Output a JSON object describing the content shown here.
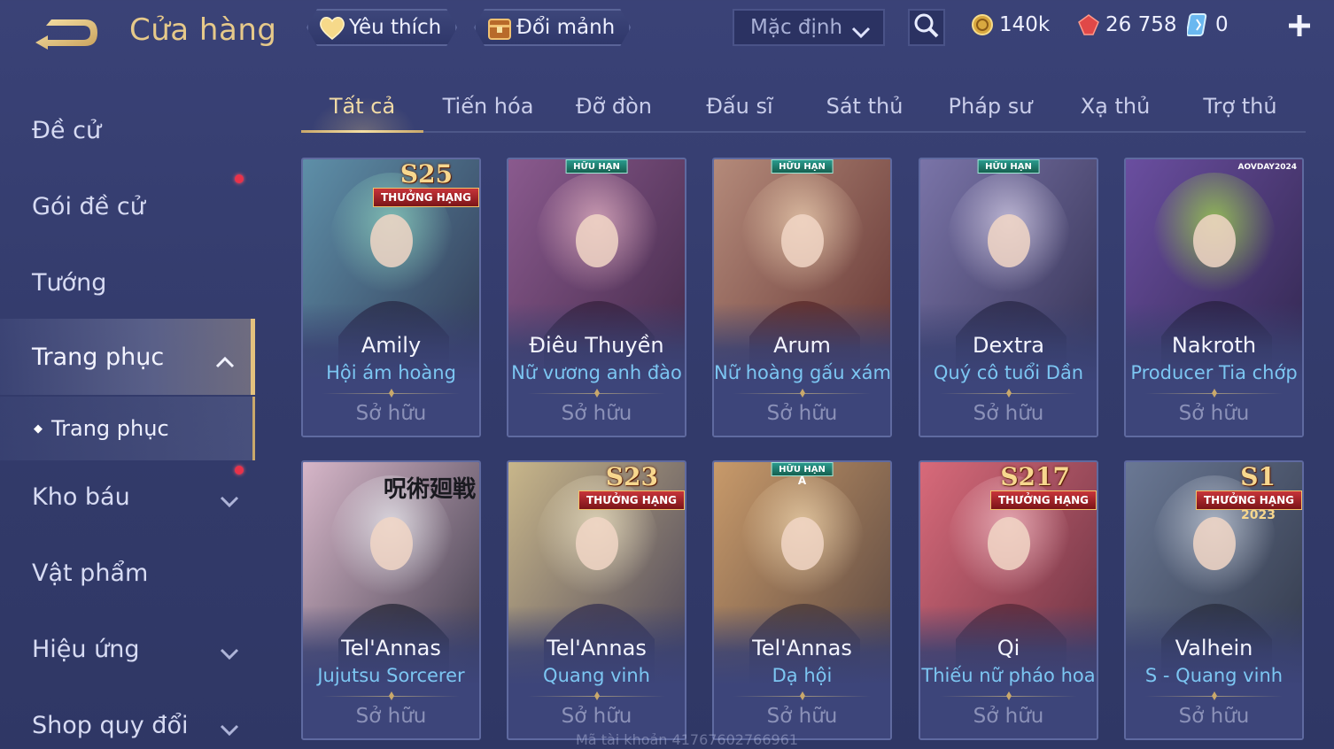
{
  "header": {
    "title": "Cửa hàng",
    "favorites_label": "Yêu thích",
    "exchange_label": "Đổi mảnh",
    "sort_value": "Mặc định",
    "gold": "140k",
    "vouchers": "26 758",
    "quan_huy": "0"
  },
  "sidebar": {
    "items": [
      {
        "label": "Đề cử"
      },
      {
        "label": "Gói đề cử"
      },
      {
        "label": "Tướng"
      },
      {
        "label": "Trang phục"
      },
      {
        "label": "Trang phục"
      },
      {
        "label": "Kho báu"
      },
      {
        "label": "Vật phẩm"
      },
      {
        "label": "Hiệu ứng"
      },
      {
        "label": "Shop quy đổi"
      }
    ]
  },
  "tabs": [
    "Tất cả",
    "Tiến hóa",
    "Đỡ đòn",
    "Đấu sĩ",
    "Sát thủ",
    "Pháp sư",
    "Xạ thủ",
    "Trợ thủ"
  ],
  "cards": [
    {
      "hero": "Amily",
      "skin": "Hội ám hoàng",
      "status": "Sở hữu",
      "badge": "THƯỞNG HẠNG",
      "season": "S25",
      "colors": [
        "#5e8fa8",
        "#2b2e4a",
        "#8fd4c0"
      ]
    },
    {
      "hero": "Điêu Thuyền",
      "skin": "Nữ vương anh đào",
      "status": "Sở hữu",
      "badge": "HỮU HẠN",
      "colors": [
        "#8a5a8e",
        "#3a2340",
        "#e7b6c6"
      ]
    },
    {
      "hero": "Arum",
      "skin": "Nữ hoàng gấu xám",
      "status": "Sở hữu",
      "badge": "HỮU HẠN",
      "colors": [
        "#b48a7a",
        "#5a2a2a",
        "#f0d3b4"
      ]
    },
    {
      "hero": "Dextra",
      "skin": "Quý cô tuổi Dần",
      "status": "Sở hữu",
      "badge": "HỮU HẠN",
      "colors": [
        "#7a74a8",
        "#2c2a4a",
        "#d9d2ea"
      ]
    },
    {
      "hero": "Nakroth",
      "skin": "Producer Tia chớp",
      "status": "Sở hữu",
      "event": "AOVDAY2024",
      "colors": [
        "#6a4ea0",
        "#2a2244",
        "#a6e04a"
      ]
    },
    {
      "hero": "Tel'Annas",
      "skin": "Jujutsu Sorcerer",
      "status": "Sở hữu",
      "event_text": "呪術廻戦",
      "colors": [
        "#d6b6c8",
        "#2a2a3a",
        "#eef0f4"
      ]
    },
    {
      "hero": "Tel'Annas",
      "skin": "Quang vinh",
      "status": "Sở hữu",
      "badge": "THƯỞNG HẠNG",
      "season": "S23",
      "colors": [
        "#c8b68a",
        "#3a3450",
        "#f0e6c8"
      ]
    },
    {
      "hero": "Tel'Annas",
      "skin": "Dạ hội",
      "status": "Sở hữu",
      "badge": "HỮU HẠN",
      "badge_top": "A",
      "colors": [
        "#c89a6a",
        "#4a3a3a",
        "#f2d8b0"
      ]
    },
    {
      "hero": "Qi",
      "skin": "Thiếu nữ pháo hoa",
      "status": "Sở hữu",
      "badge": "THƯỞNG HẠNG",
      "season": "S217",
      "colors": [
        "#d86a7a",
        "#5a2a3a",
        "#f5c0c8"
      ]
    },
    {
      "hero": "Valhein",
      "skin": "S - Quang vinh",
      "status": "Sở hữu",
      "badge": "THƯỞNG HẠNG",
      "season": "S1",
      "year": "2023",
      "colors": [
        "#6a7894",
        "#2a3040",
        "#c8d0dc"
      ]
    }
  ],
  "watermark": "Mã tài khoản 417676027669​61"
}
